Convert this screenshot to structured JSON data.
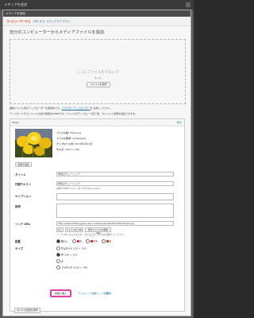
{
  "window": {
    "title": "メディアを追加"
  },
  "subheader": {
    "title": "メディアを追加"
  },
  "tabs": [
    {
      "label": "コンピューターから",
      "active": true
    },
    {
      "label": "URL から",
      "active": false
    },
    {
      "label": "メディアライブラリ",
      "active": false
    }
  ],
  "upload": {
    "title": "自分のコンピューターからメディアファイルを追加",
    "drop_title": "ここにファイルをドロップ",
    "drop_or": "または",
    "select_button": "ファイルを選択",
    "note1_prefix": "複数ファイル用のアップローダーを使用中です。",
    "note1_link": "ブラウザーアップローダー",
    "note1_suffix": "を お試しください。",
    "note2": "アップロードするファイルの最大容量は50MBです。ファイルのアップロード完了後、タイトルと説明を追加できます。"
  },
  "file": {
    "header_name": "Tulips",
    "hide_link": "隠す",
    "filename_label": "ファイル名:",
    "filename": "Tulips.jpg",
    "filetype_label": "ファイル形式:",
    "filetype": "image/jpeg",
    "upload_date_label": "アップロード日:",
    "upload_date": "2014年2月14日",
    "size_label": "サイズ:",
    "size": "1024 × 768",
    "edit_image_button": "画像を編集"
  },
  "fields": {
    "title_label": "タイトル",
    "title_value": "黄色のチューリップ",
    "alt_label": "代替テキスト",
    "alt_value": "黄色のチューリップ",
    "alt_hint": "画像の代替テキスト (例: \"The Mona Lisa\")",
    "caption_label": "キャプション",
    "desc_label": "説明",
    "link_label": "リンク URL",
    "link_value": "http://www.mitblog.jp/su.wp-content/uploads/2014/02/Tulips.jpg",
    "link_none": "なし",
    "link_file": "ファイルの URL",
    "link_post": "添付ファイルの投稿 URL",
    "link_hint": "リンク URL を入力するか、または上のいずれかを選択してください。",
    "align_label": "配置",
    "align_none": "なし",
    "align_left": "左",
    "align_center": "中央",
    "align_right": "右",
    "size_label": "サイズ",
    "size_thumb": "サムネイル",
    "size_thumb_dim": "(150 × 150)",
    "size_medium": "中",
    "size_medium_dim": "(300 × 225)",
    "size_large": "大",
    "size_full": "フルサイズ",
    "size_full_dim": "(1024 × 768)"
  },
  "actions": {
    "insert": "投稿に挿入",
    "use_as_gallery": "アイキャッチ画像として使用",
    "delete": "削除",
    "save_all": "すべての変更を保存"
  },
  "colors": {
    "accent": "#d54e21",
    "link": "#21759b",
    "highlight": "#e040a0"
  }
}
